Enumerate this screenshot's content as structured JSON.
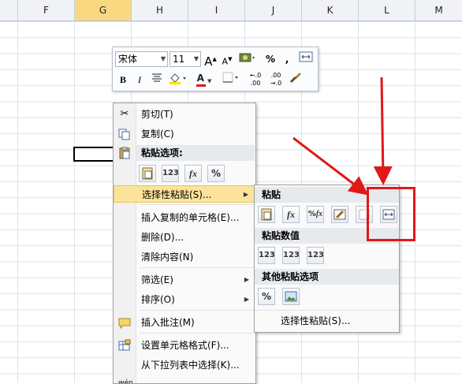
{
  "columns": [
    "F",
    "G",
    "H",
    "I",
    "J",
    "K",
    "L",
    "M"
  ],
  "selected_column": "G",
  "mini_toolbar": {
    "font_name": "宋体",
    "font_size": "11",
    "grow_font": "A",
    "shrink_font": "A",
    "percent": "%",
    "comma": ",",
    "bold": "B",
    "italic": "I",
    "font_color_letter": "A",
    "inc_decimal": ".0",
    "dec_decimal": ".00"
  },
  "menu": {
    "cut": "剪切(T)",
    "copy": "复制(C)",
    "paste_options_header": "粘贴选项:",
    "paste_special": "选择性粘贴(S)...",
    "insert_copied": "插入复制的单元格(E)...",
    "delete": "删除(D)...",
    "clear": "清除内容(N)",
    "filter": "筛选(E)",
    "sort": "排序(O)",
    "insert_comment": "插入批注(M)",
    "format_cells": "设置单元格格式(F)...",
    "pick_list": "从下拉列表中选择(K)..."
  },
  "submenu": {
    "paste_header": "粘贴",
    "paste_values_header": "粘贴数值",
    "other_header": "其他粘贴选项",
    "paste_special": "选择性粘贴(S)..."
  },
  "icons": {
    "pct": "%",
    "fx": "fx",
    "num": "123"
  },
  "colors": {
    "highlight": "#fbe39b",
    "arrow": "#e01818"
  }
}
